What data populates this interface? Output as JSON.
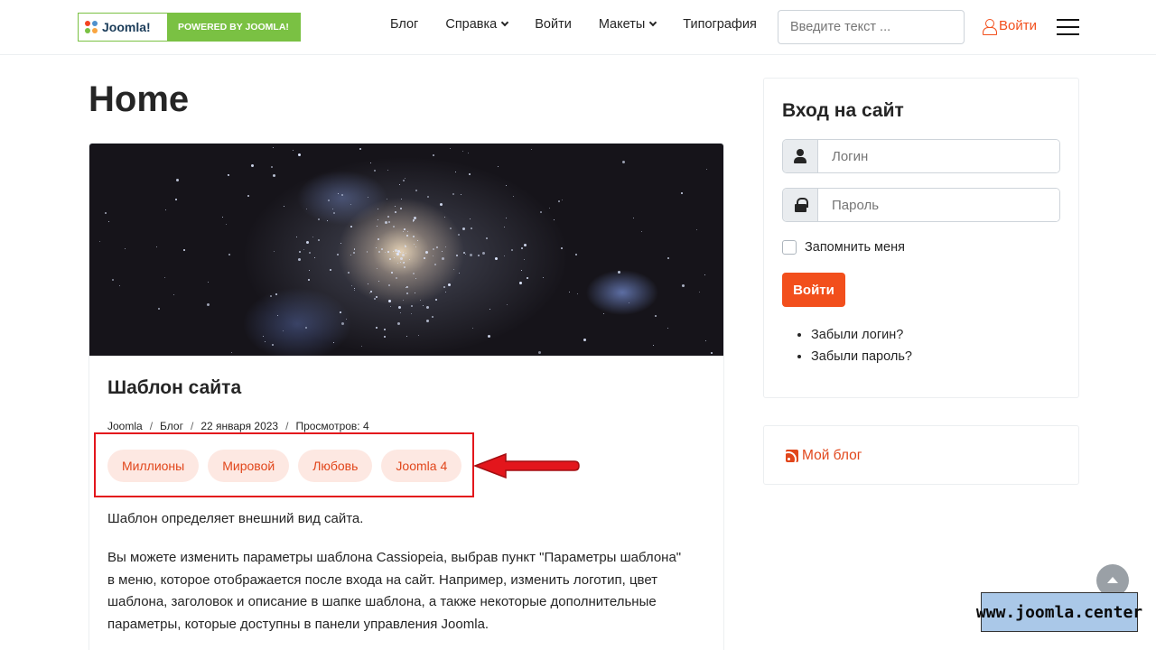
{
  "header": {
    "logo_text": "Joomla!",
    "powered_label": "POWERED BY JOOMLA!",
    "nav": [
      {
        "label": "Блог",
        "has_dropdown": false
      },
      {
        "label": "Справка",
        "has_dropdown": true
      },
      {
        "label": "Войти",
        "has_dropdown": false
      },
      {
        "label": "Макеты",
        "has_dropdown": true
      },
      {
        "label": "Типография",
        "has_dropdown": false
      }
    ],
    "search_placeholder": "Введите текст ...",
    "login_label": "Войти",
    "menu_icon": "hamburger-icon"
  },
  "main": {
    "page_title": "Home",
    "article": {
      "image_icon": "galaxy-image",
      "title": "Шаблон сайта",
      "meta": {
        "category": "Joomla",
        "subcategory": "Блог",
        "date": "22 января 2023",
        "views": "Просмотров: 4"
      },
      "tags": [
        "Миллионы",
        "Мировой",
        "Любовь",
        "Joomla 4"
      ],
      "paragraph1": "Шаблон определяет внешний вид сайта.",
      "paragraph2": "Вы можете изменить параметры шаблона Cassiopeia, выбрав пункт \"Параметры шаблона\" в меню, которое отображается после входа на сайт. Например, изменить логотип, цвет шаблона, заголовок и описание в шапке шаблона, а также некоторые дополнительные параметры, которые доступны в панели управления Joomla."
    }
  },
  "sidebar": {
    "login": {
      "title": "Вход на сайт",
      "username_placeholder": "Логин",
      "password_placeholder": "Пароль",
      "remember_label": "Запомнить меня",
      "submit_label": "Войти",
      "links": [
        "Забыли логин?",
        "Забыли пароль?"
      ]
    },
    "blog_link": "Мой блог"
  },
  "watermark": "www.joomla.center",
  "colors": {
    "accent": "#f24f1c",
    "tag_bg": "#fde8e2",
    "annotation_red": "#e3161c",
    "powered_green": "#7ac143"
  }
}
